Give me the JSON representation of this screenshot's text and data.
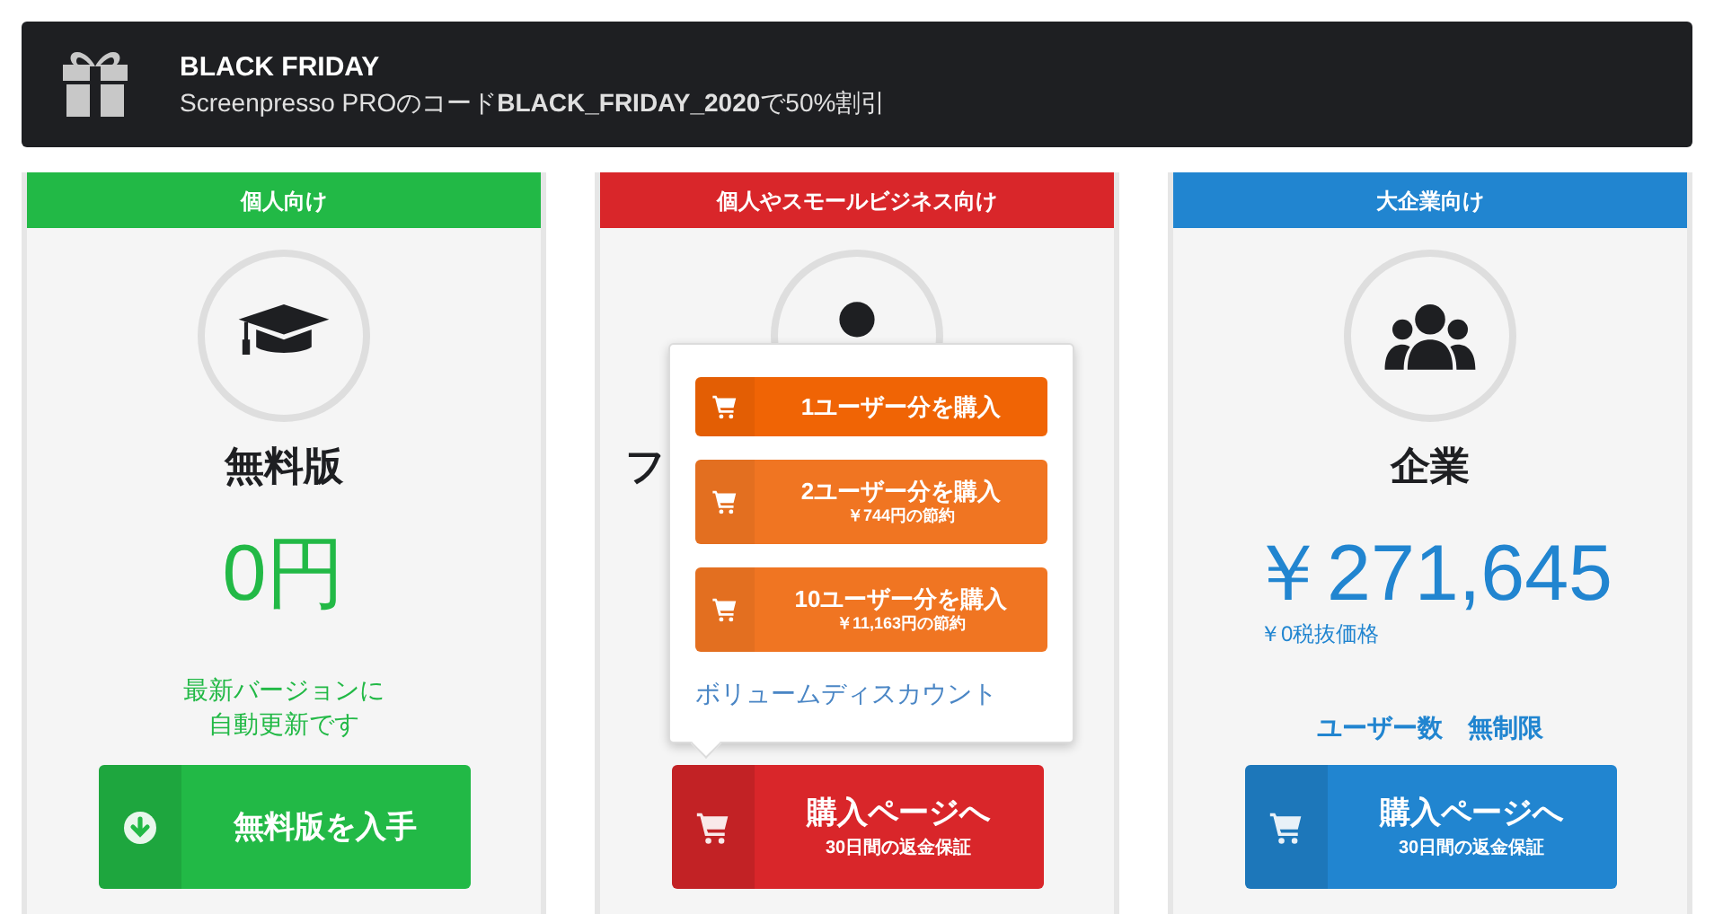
{
  "banner": {
    "title": "BLACK FRIDAY",
    "text": "Screenpresso PROのコード**BLACK_FRIDAY_2020**で50%割引"
  },
  "plans": [
    {
      "kind": "free",
      "color": "#22b946",
      "audience": "個人向け",
      "title": "無料版",
      "covered": false,
      "price": "0円",
      "notes": [
        "最新バージョンに",
        "自動更新です"
      ],
      "button": {
        "label": "無料版を入手"
      }
    },
    {
      "kind": "pro",
      "color": "#d9262a",
      "audience": "個人やスモールビジネス向け",
      "title": "フ",
      "covered": true,
      "button": {
        "label": "購入ページへ",
        "sub": "30日間の返金保証"
      },
      "popover": {
        "options": [
          {
            "label": "1ユーザー分を購入",
            "highlighted": true
          },
          {
            "label": "2ユーザー分を購入",
            "saving": "￥744円の節約",
            "highlighted": false
          },
          {
            "label": "10ユーザー分を購入",
            "saving": "￥11,163円の節約",
            "highlighted": false
          }
        ],
        "link": "ボリュームディスカウント"
      }
    },
    {
      "kind": "enterprise",
      "color": "#2185d0",
      "audience": "大企業向け",
      "title": "企業",
      "covered": false,
      "price": "￥271,645",
      "price_note": "￥0税抜価格",
      "users": "ユーザー数　無制限",
      "button": {
        "label": "購入ページへ",
        "sub": "30日間の返金保証"
      }
    }
  ]
}
